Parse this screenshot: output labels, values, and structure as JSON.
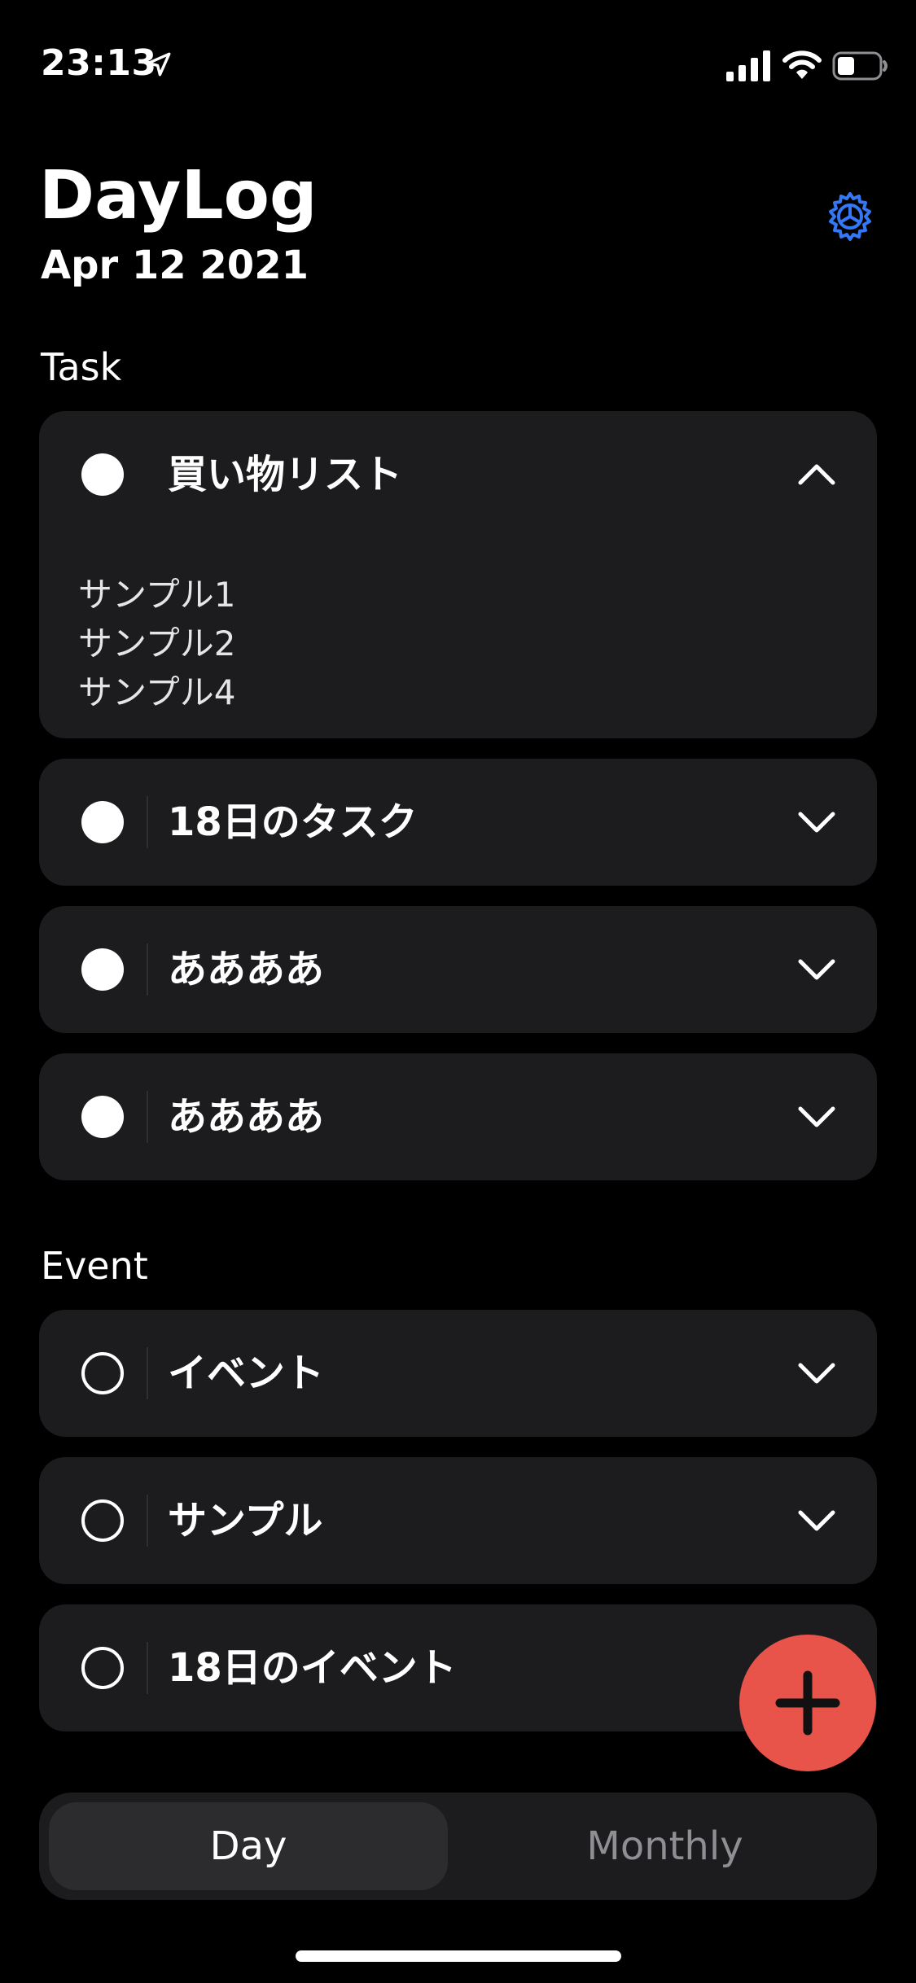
{
  "status_bar": {
    "time": "23:13"
  },
  "header": {
    "title": "DayLog",
    "date": "Apr 12 2021"
  },
  "task_section": {
    "label": "Task",
    "items": [
      {
        "title": "買い物リスト",
        "expanded": true,
        "notes": [
          "サンプル1",
          "サンプル2",
          "サンプル4"
        ]
      },
      {
        "title": "18日のタスク",
        "expanded": false
      },
      {
        "title": "ああああ",
        "expanded": false
      },
      {
        "title": "ああああ",
        "expanded": false
      }
    ]
  },
  "event_section": {
    "label": "Event",
    "items": [
      {
        "title": "イベント",
        "expanded": false
      },
      {
        "title": "サンプル",
        "expanded": false
      },
      {
        "title": "18日のイベント",
        "expanded": false
      }
    ]
  },
  "segmented": {
    "day_label": "Day",
    "monthly_label": "Monthly",
    "selected": "Day"
  },
  "colors": {
    "background": "#000000",
    "card": "#1c1c1e",
    "accent": "#3478f6",
    "fab": "#e8534a"
  },
  "icons": {
    "settings": "gear-icon",
    "add": "plus-icon",
    "collapse": "chevron-up-icon",
    "expand": "chevron-down-icon"
  }
}
